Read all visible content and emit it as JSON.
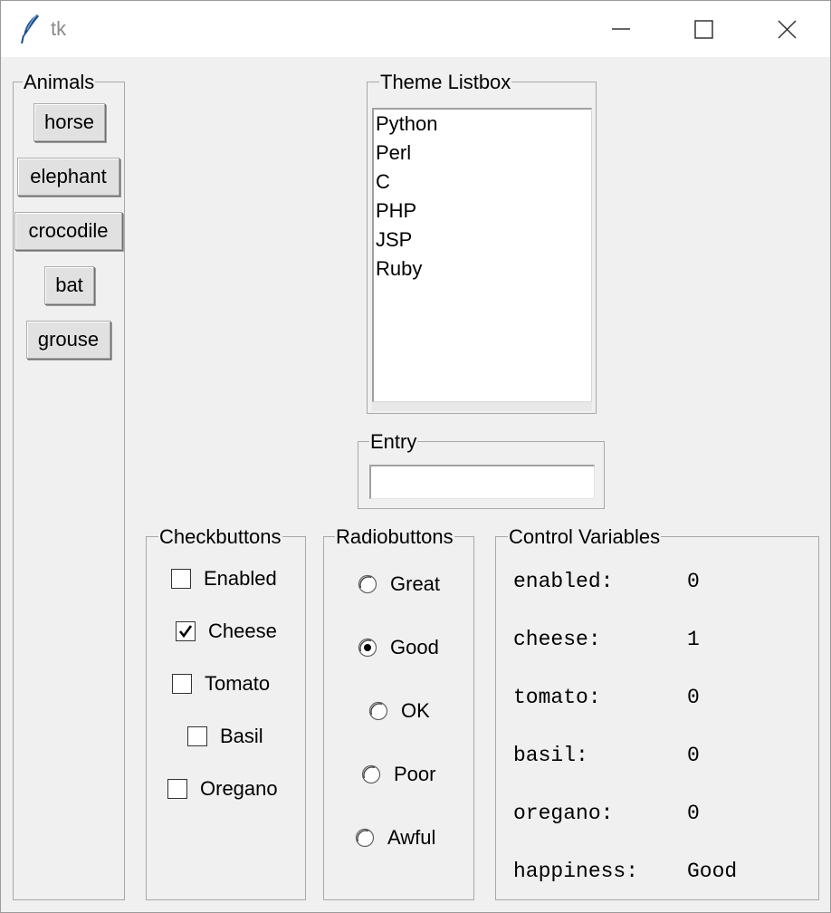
{
  "window": {
    "title": "tk",
    "controls": [
      "minimize",
      "maximize",
      "close"
    ]
  },
  "animals": {
    "title": "Animals",
    "buttons": [
      "horse",
      "elephant",
      "crocodile",
      "bat",
      "grouse"
    ]
  },
  "theme_listbox": {
    "title": "Theme Listbox",
    "items": [
      "Python",
      "Perl",
      "C",
      "PHP",
      "JSP",
      "Ruby"
    ]
  },
  "entry": {
    "title": "Entry",
    "value": ""
  },
  "checkbuttons": {
    "title": "Checkbuttons",
    "items": [
      {
        "label": "Enabled",
        "checked": false
      },
      {
        "label": "Cheese",
        "checked": true
      },
      {
        "label": "Tomato",
        "checked": false
      },
      {
        "label": "Basil",
        "checked": false
      },
      {
        "label": "Oregano",
        "checked": false
      }
    ]
  },
  "radiobuttons": {
    "title": "Radiobuttons",
    "items": [
      {
        "label": "Great",
        "selected": false
      },
      {
        "label": "Good",
        "selected": true
      },
      {
        "label": "OK",
        "selected": false
      },
      {
        "label": "Poor",
        "selected": false
      },
      {
        "label": "Awful",
        "selected": false
      }
    ]
  },
  "control_variables": {
    "title": "Control Variables",
    "rows": [
      {
        "name": "enabled:",
        "value": "0"
      },
      {
        "name": "cheese:",
        "value": "1"
      },
      {
        "name": "tomato:",
        "value": "0"
      },
      {
        "name": "basil:",
        "value": "0"
      },
      {
        "name": "oregano:",
        "value": "0"
      },
      {
        "name": "happiness:",
        "value": "Good"
      }
    ]
  }
}
